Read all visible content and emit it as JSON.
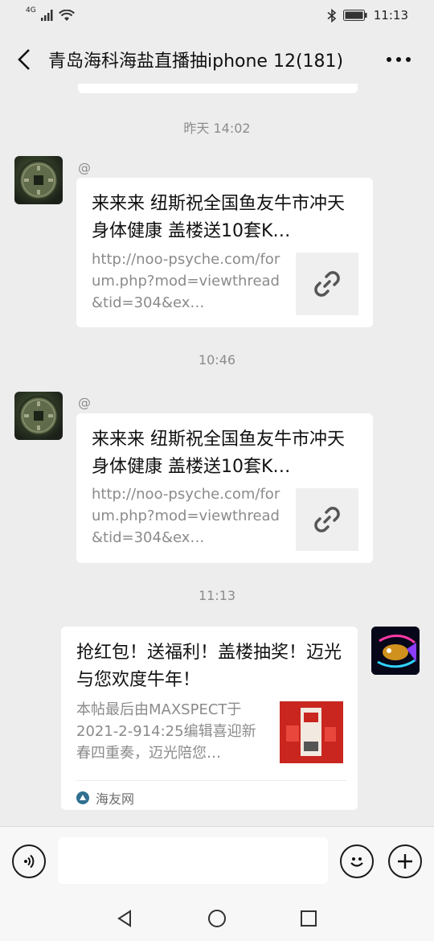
{
  "status_bar": {
    "network": "4G",
    "time": "11:13"
  },
  "header": {
    "title": "青岛海科海盐直播抽iphone 12(181)"
  },
  "timestamps": [
    "昨天 14:02",
    "10:46",
    "11:13"
  ],
  "messages": [
    {
      "at": "@",
      "title": "来来来 纽斯祝全国鱼友牛市冲天 身体健康 盖楼送10套K…",
      "desc": "http://noo-psyche.com/forum.php?mod=viewthread&tid=304&ex…",
      "icon": "link-icon"
    },
    {
      "at": "@",
      "title": "来来来 纽斯祝全国鱼友牛市冲天 身体健康 盖楼送10套K…",
      "desc": "http://noo-psyche.com/forum.php?mod=viewthread&tid=304&ex…",
      "icon": "link-icon"
    },
    {
      "title": "抢红包！送福利！盖楼抽奖！迈光与您欢度牛年！",
      "desc": "本帖最后由MAXSPECT于2021-2-914:25编辑喜迎新春四重奏，迈光陪您…",
      "source": "海友网",
      "thumb_colors": [
        "#c8261f",
        "#f2e9e1"
      ]
    }
  ],
  "input_bar": {
    "placeholder": "",
    "icons": [
      "voice-icon",
      "emoji-icon",
      "plus-icon"
    ]
  },
  "nav": {
    "icons": [
      "nav-back-icon",
      "nav-home-icon",
      "nav-recent-icon"
    ]
  },
  "colors": {
    "background": "#ededed",
    "bubble": "#ffffff",
    "muted": "#8c8c8c"
  }
}
